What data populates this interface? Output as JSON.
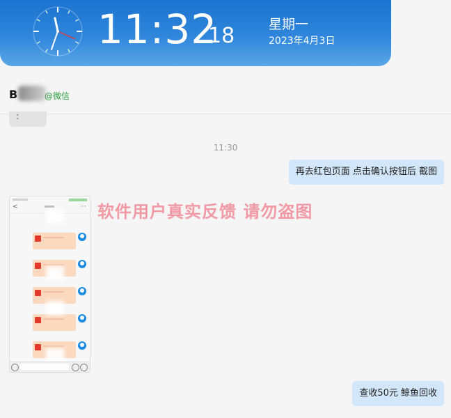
{
  "clock": {
    "time": "11:32",
    "seconds": "18",
    "weekday": "星期一",
    "date": "2023年4月3日"
  },
  "chat": {
    "contact_name": "B",
    "wechat_tag": "@微信",
    "prev_bubble_text": ":",
    "timestamp": "11:30",
    "messages": [
      {
        "text": "再去红包页面 点击确认按钮后 截图",
        "side": "right"
      },
      {
        "text": "查收50元 鲸鱼回收",
        "side": "right"
      }
    ],
    "watermark": "软件用户真实反馈  请勿盗图"
  },
  "thumbnail": {
    "redpacket_count": 5,
    "back_glyph": "<",
    "menu_glyph": "···"
  },
  "colors": {
    "banner": "#1a73cf",
    "bubble": "#d2e7f9",
    "watermark": "#f19aa6",
    "wechat_green": "#2a9a3c"
  }
}
